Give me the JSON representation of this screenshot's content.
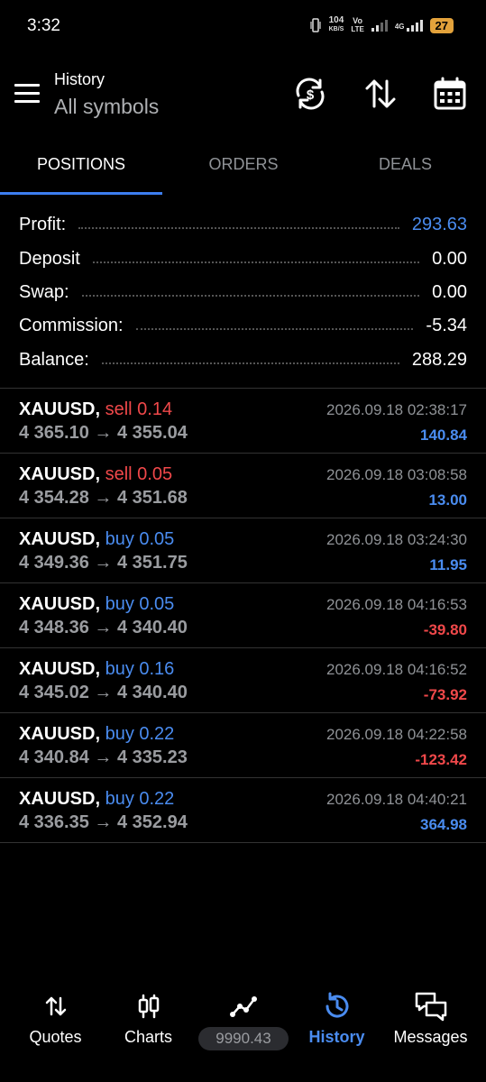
{
  "status_bar": {
    "time": "3:32",
    "speed_value": "104",
    "speed_unit": "KB/S",
    "volte": "Vo",
    "lte": "LTE",
    "network": "4G",
    "battery": "27"
  },
  "header": {
    "title": "History",
    "subtitle": "All symbols",
    "icons": [
      "currency-sync-icon",
      "sort-icon",
      "calendar-icon"
    ]
  },
  "tabs": [
    {
      "label": "POSITIONS",
      "active": true
    },
    {
      "label": "ORDERS",
      "active": false
    },
    {
      "label": "DEALS",
      "active": false
    }
  ],
  "summary": [
    {
      "label": "Profit:",
      "value": "293.63"
    },
    {
      "label": "Deposit",
      "value": "0.00"
    },
    {
      "label": "Swap:",
      "value": "0.00"
    },
    {
      "label": "Commission:",
      "value": "-5.34"
    },
    {
      "label": "Balance:",
      "value": "288.29"
    }
  ],
  "deals": [
    {
      "symbol": "XAUUSD,",
      "side": "sell 0.14",
      "open": "4 365.10",
      "arrow": "→",
      "close": "4 355.04",
      "time": "2026.09.18 02:38:17",
      "profit": "140.84"
    },
    {
      "symbol": "XAUUSD,",
      "side": "sell 0.05",
      "open": "4 354.28",
      "arrow": "→",
      "close": "4 351.68",
      "time": "2026.09.18 03:08:58",
      "profit": "13.00"
    },
    {
      "symbol": "XAUUSD,",
      "side": "buy 0.05",
      "open": "4 349.36",
      "arrow": "→",
      "close": "4 351.75",
      "time": "2026.09.18 03:24:30",
      "profit": "11.95"
    },
    {
      "symbol": "XAUUSD,",
      "side": "buy 0.05",
      "open": "4 348.36",
      "arrow": "→",
      "close": "4 340.40",
      "time": "2026.09.18 04:16:53",
      "profit": "-39.80"
    },
    {
      "symbol": "XAUUSD,",
      "side": "buy 0.16",
      "open": "4 345.02",
      "arrow": "→",
      "close": "4 340.40",
      "time": "2026.09.18 04:16:52",
      "profit": "-73.92"
    },
    {
      "symbol": "XAUUSD,",
      "side": "buy 0.22",
      "open": "4 340.84",
      "arrow": "→",
      "close": "4 335.23",
      "time": "2026.09.18 04:22:58",
      "profit": "-123.42"
    },
    {
      "symbol": "XAUUSD,",
      "side": "buy 0.22",
      "open": "4 336.35",
      "arrow": "→",
      "close": "4 352.94",
      "time": "2026.09.18 04:40:21",
      "profit": "364.98"
    }
  ],
  "nav": [
    {
      "label": "Quotes",
      "icon": "quotes-icon",
      "active": false
    },
    {
      "label": "Charts",
      "icon": "charts-icon",
      "active": false
    },
    {
      "label": "",
      "icon": "trade-icon",
      "active": false
    },
    {
      "label": "History",
      "icon": "history-icon",
      "active": true
    },
    {
      "label": "Messages",
      "icon": "messages-icon",
      "active": false
    }
  ],
  "equity": "9990.43",
  "colors": {
    "accent": "#3d7ef0",
    "profit_positive": "#4a8cf0",
    "profit_negative": "#f0484a",
    "background": "#000000"
  }
}
